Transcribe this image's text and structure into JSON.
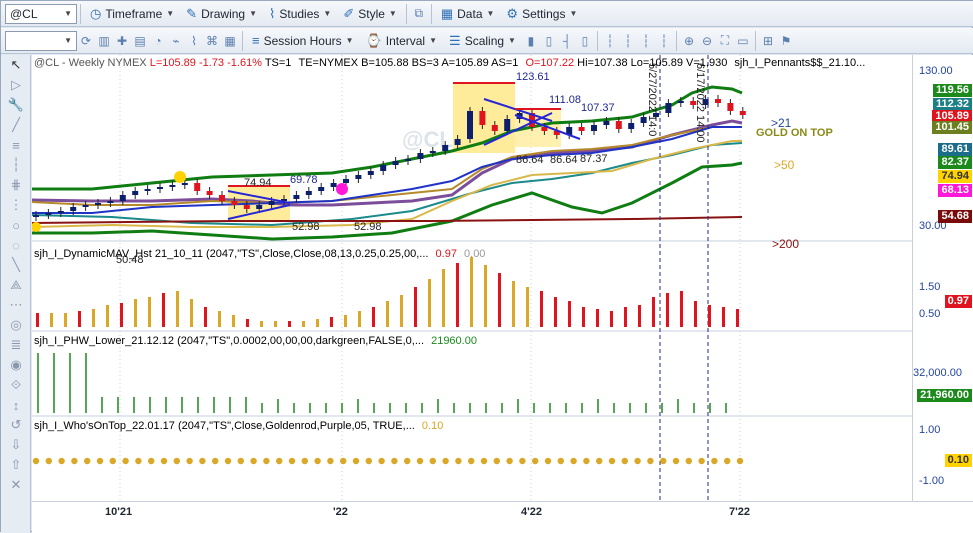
{
  "toolbar1": {
    "symbol": "@CL",
    "timeframe": "Timeframe",
    "drawing": "Drawing",
    "studies": "Studies",
    "style": "Style",
    "data": "Data",
    "settings": "Settings"
  },
  "toolbar2": {
    "session_hours": "Session Hours",
    "interval": "Interval",
    "scaling": "Scaling"
  },
  "header": {
    "symbol": "@CL - Weekly",
    "exchange": "NYMEX",
    "L": "L=105.89",
    "chg": "-1.73",
    "pct": "-1.61%",
    "ts": "TS=1",
    "te": "TE=NYMEX",
    "b": "B=105.88",
    "bs": "BS=3",
    "a": "A=105.89",
    "as": "AS=1",
    "o": "O=107.22",
    "hi": "Hi=107.38",
    "lo": "Lo=105.89",
    "v": "V=1,930",
    "study": "sjh_I_Pennants$$_21.10..."
  },
  "watermark": "@CL",
  "price_labels": {
    "p1": "123.61",
    "p2": "111.08",
    "p3": "107.37",
    "p4": "74.94",
    "p5": "69.78",
    "p6": "86.64",
    "p7": "86.64",
    "p8": "87.37",
    "p9": "52.98",
    "p10": "52.98",
    "p11": "50.48",
    "d1": "5/27/2022 14:0",
    "d2": "6/17/2022 14:00"
  },
  "annotations": {
    "gt21": ">21",
    "gold": "GOLD ON TOP",
    "gt50": ">50",
    "gt200": ">200"
  },
  "panel2": {
    "title": "sjh_I_DynamicMAV_Hst 21_10_11 (2047,\"TS\",Close,Close,08,13,0.25,0.25,00,...",
    "v1": "0.97",
    "v2": "0.00"
  },
  "panel3": {
    "title": "sjh_I_PHW_Lower_21.12.12 (2047,\"TS\",0.0002,00,00,00,darkgreen,FALSE,0,...",
    "v1": "21960.00"
  },
  "panel4": {
    "title": "sjh_I_Who'sOnTop_22.01.17 (2047,\"TS\",Close,Goldenrod,Purple,05, TRUE,...",
    "v1": "0.10"
  },
  "axis": {
    "main_ticks": [
      "130.00",
      "30.00"
    ],
    "tags": [
      {
        "text": "119.56",
        "bg": "#1b8a1b",
        "fg": "#ffffff"
      },
      {
        "text": "112.32",
        "bg": "#1d7f86",
        "fg": "#ffffff"
      },
      {
        "text": "105.89",
        "bg": "#e0141e",
        "fg": "#ffffff"
      },
      {
        "text": "101.45",
        "bg": "#6b7f1f",
        "fg": "#ffffff"
      },
      {
        "text": "89.61",
        "bg": "#1b6d8a",
        "fg": "#ffffff"
      },
      {
        "text": "82.37",
        "bg": "#1a8a1a",
        "fg": "#ffffff"
      },
      {
        "text": "74.94",
        "bg": "#ffd200",
        "fg": "#333333"
      },
      {
        "text": "68.13",
        "bg": "#ff18d8",
        "fg": "#ffffff"
      },
      {
        "text": "54.68",
        "bg": "#7a0b0b",
        "fg": "#ffffff"
      }
    ],
    "p2_ticks": [
      "1.50",
      "0.50"
    ],
    "p2_tag": "0.97",
    "p3_ticks": [
      "32,000.00"
    ],
    "p3_tag": "21,960.00",
    "p4_ticks": [
      "1.00",
      "-1.00"
    ],
    "p4_tag": "0.10",
    "x_ticks": [
      "10'21",
      "'22",
      "4'22",
      "7'22"
    ]
  },
  "colors": {
    "up": "#0c1f6b",
    "down": "#e0141e",
    "gold": "#d9a827",
    "green": "#1b8a1b"
  }
}
